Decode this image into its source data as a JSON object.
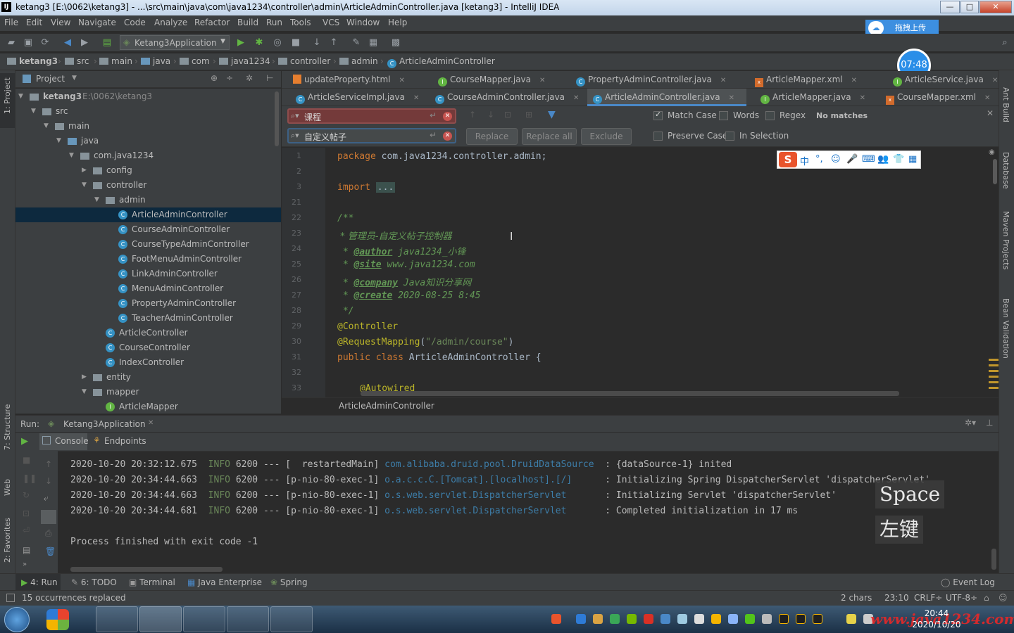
{
  "window": {
    "title": "ketang3 [E:\\0062\\ketang3] - ...\\src\\main\\java\\com\\java1234\\controller\\admin\\ArticleAdminController.java [ketang3] - IntelliJ IDEA",
    "logo": "IJ",
    "min": "—",
    "max": "□",
    "close": "✕"
  },
  "menu": [
    "File",
    "Edit",
    "View",
    "Navigate",
    "Code",
    "Analyze",
    "Refactor",
    "Build",
    "Run",
    "Tools",
    "VCS",
    "Window",
    "Help"
  ],
  "upload_button": "拖拽上传",
  "clock_badge": "07:48",
  "run_config": "Ketang3Application",
  "breadcrumbs": [
    "ketang3",
    "src",
    "main",
    "java",
    "com",
    "java1234",
    "controller",
    "admin",
    "ArticleAdminController"
  ],
  "project": {
    "header": "Project",
    "tree": [
      {
        "label": "ketang3",
        "extra": "E:\\0062\\ketang3"
      },
      {
        "label": "src"
      },
      {
        "label": "main"
      },
      {
        "label": "java"
      },
      {
        "label": "com.java1234"
      },
      {
        "label": "config"
      },
      {
        "label": "controller"
      },
      {
        "label": "admin"
      },
      {
        "label": "ArticleAdminController"
      },
      {
        "label": "CourseAdminController"
      },
      {
        "label": "CourseTypeAdminController"
      },
      {
        "label": "FootMenuAdminController"
      },
      {
        "label": "LinkAdminController"
      },
      {
        "label": "MenuAdminController"
      },
      {
        "label": "PropertyAdminController"
      },
      {
        "label": "TeacherAdminController"
      },
      {
        "label": "ArticleController"
      },
      {
        "label": "CourseController"
      },
      {
        "label": "IndexController"
      },
      {
        "label": "entity"
      },
      {
        "label": "mapper"
      },
      {
        "label": "ArticleMapper"
      }
    ]
  },
  "left_stripe": [
    "1: Project",
    "7: Structure",
    "Web",
    "2: Favorites"
  ],
  "right_stripe": [
    "Ant Build",
    "Database",
    "Maven Projects",
    "Bean Validation"
  ],
  "tabs_row1": [
    "updateProperty.html",
    "CourseMapper.java",
    "PropertyAdminController.java",
    "ArticleMapper.xml",
    "ArticleService.java"
  ],
  "tabs_row2": [
    "ArticleServiceImpl.java",
    "CourseAdminController.java",
    "ArticleAdminController.java",
    "ArticleMapper.java",
    "CourseMapper.xml"
  ],
  "find": {
    "search_value": "课程",
    "replace_value": "自定义帖子",
    "match_case": "Match Case",
    "words": "Words",
    "regex": "Regex",
    "status": "No matches",
    "replace": "Replace",
    "replace_all": "Replace all",
    "exclude": "Exclude",
    "preserve_case": "Preserve Case",
    "in_selection": "In Selection"
  },
  "editor": {
    "line_numbers": [
      "1",
      "2",
      "3",
      "21",
      "22",
      "23",
      "24",
      "25",
      "26",
      "27",
      "28",
      "29",
      "30",
      "31",
      "32",
      "33"
    ],
    "breadcrumb": "ArticleAdminController",
    "lines": {
      "package_kw": "package",
      "package_name": " com.java1234.controller.admin;",
      "import_kw": "import",
      "import_folded": "...",
      "doc_open": "/**",
      "doc_title": " * 管理员-自定义帖子控制器",
      "author_tag": "@author",
      "author_val": " java1234_小锋",
      "site_tag": "@site",
      "site_val": " www.java1234.com",
      "company_tag": "@company",
      "company_val": " Java知识分享网",
      "create_tag": "@create",
      "create_val": " 2020-08-25 8:45",
      "doc_close": " */",
      "ann_controller": "@Controller",
      "ann_mapping": "@RequestMapping",
      "mapping_arg_open": "(",
      "mapping_str": "\"/admin/course\"",
      "mapping_arg_close": ")",
      "class_kw": "public class",
      "class_name": " ArticleAdminController {",
      "autowired": "@Autowired"
    }
  },
  "ime": {
    "s": "S",
    "items": [
      "中",
      "°,",
      "☺",
      "🎤",
      "⌨",
      "👥",
      "👕",
      "▦"
    ]
  },
  "run": {
    "label": "Run:",
    "config": "Ketang3Application",
    "console_tab": "Console",
    "endpoints_tab": "Endpoints",
    "log": [
      {
        "ts": "2020-10-20 20:32:12.675",
        "level": "INFO",
        "pid": "6200",
        "sep": "---",
        "thread": "[  restartedMain]",
        "cls": "com.alibaba.druid.pool.DruidDataSource  ",
        "msg": ": {dataSource-1} inited"
      },
      {
        "ts": "2020-10-20 20:34:44.663",
        "level": "INFO",
        "pid": "6200",
        "sep": "---",
        "thread": "[p-nio-80-exec-1]",
        "cls": "o.a.c.c.C.[Tomcat].[localhost].[/]      ",
        "msg": ": Initializing Spring DispatcherServlet 'dispatcherServlet'"
      },
      {
        "ts": "2020-10-20 20:34:44.663",
        "level": "INFO",
        "pid": "6200",
        "sep": "---",
        "thread": "[p-nio-80-exec-1]",
        "cls": "o.s.web.servlet.DispatcherServlet       ",
        "msg": ": Initializing Servlet 'dispatcherServlet'"
      },
      {
        "ts": "2020-10-20 20:34:44.681",
        "level": "INFO",
        "pid": "6200",
        "sep": "---",
        "thread": "[p-nio-80-exec-1]",
        "cls": "o.s.web.servlet.DispatcherServlet       ",
        "msg": ": Completed initialization in 17 ms"
      }
    ],
    "exit": "Process finished with exit code -1"
  },
  "key_overlay": [
    "Space",
    "左键"
  ],
  "bottom_tools": [
    "4: Run",
    "6: TODO",
    "Terminal",
    "Java Enterprise",
    "Spring"
  ],
  "event_log": "Event Log",
  "status": {
    "message": "15 occurrences replaced",
    "chars": "2 chars",
    "position": "23:10",
    "line_sep": "CRLF÷",
    "encoding": "UTF-8÷"
  },
  "taskbar": {
    "time": "20:44",
    "date": "2020/10/20",
    "watermark": "www.java1234.com"
  }
}
